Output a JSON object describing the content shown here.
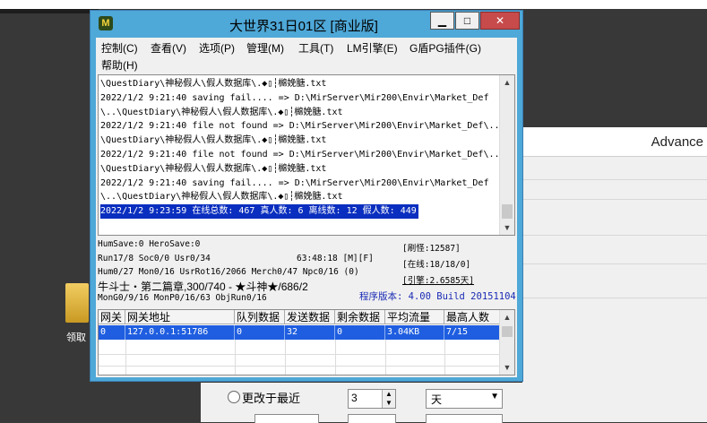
{
  "desktop": {
    "folder_label": "领取"
  },
  "bg_window": {
    "header_text": "Advance",
    "radio_label": "更改于最近",
    "spin_value": "3",
    "select_value": "天"
  },
  "window": {
    "title": "大世界31日01区 [商业版]",
    "buttons": {
      "minimize": "▁",
      "maximize": "□",
      "close": "✕"
    },
    "menu": [
      "控制(C)",
      "查看(V)",
      "选项(P)",
      "管理(M)",
      "工具(T)",
      "LM引擎(E)",
      "G盾PG插件(G)",
      "帮助(H)"
    ],
    "log_lines": [
      "\\QuestDiary\\神秘假人\\假人数据库\\.◆▯┆檰娩膅.txt",
      "2022/1/2 9:21:40 saving fail.... => D:\\MirServer\\Mir200\\Envir\\Market_Def",
      "\\..\\QuestDiary\\神秘假人\\假人数据库\\.◆▯┆檰娩膅.txt",
      "2022/1/2 9:21:40 file not found => D:\\MirServer\\Mir200\\Envir\\Market_Def\\..",
      "\\QuestDiary\\神秘假人\\假人数据库\\.◆▯┆檰娩膅.txt",
      "2022/1/2 9:21:40 file not found => D:\\MirServer\\Mir200\\Envir\\Market_Def\\..",
      "\\QuestDiary\\神秘假人\\假人数据库\\.◆▯┆檰娩膅.txt",
      "2022/1/2 9:21:40 saving fail.... => D:\\MirServer\\Mir200\\Envir\\Market_Def",
      "\\..\\QuestDiary\\神秘假人\\假人数据库\\.◆▯┆檰娩膅.txt"
    ],
    "log_selected": "2022/1/2 9:23:59 在线总数: 467 真人数: 6 离线数: 12 假人数: 449",
    "stats": {
      "humsave": "HumSave:0 HeroSave:0",
      "run": "Run17/8 Soc0/0 Usr0/34",
      "time": "63:48:18 [M][F]",
      "hum": "Hum0/27 Mon0/16 UsrRot16/2066 Merch0/47 Npc0/16 (0)",
      "fighter": "牛斗士・第二篇章,300/740 - ★斗神★/686/2",
      "mon": "MonG0/9/16 MonP0/16/63 ObjRun0/16",
      "refresh": "[刷怪:12587]",
      "online": "[在线:18/18/0]",
      "engine": "[引擎:2.6585天]",
      "version": "程序版本: 4.00 Build 20151104"
    },
    "grid": {
      "headers": [
        "网关",
        "网关地址",
        "队列数据",
        "发送数据",
        "剩余数据",
        "平均流量",
        "最高人数"
      ],
      "rows": [
        [
          "0",
          "127.0.0.1:51786",
          "0",
          "32",
          "0",
          "3.04KB",
          "7/15"
        ]
      ]
    }
  }
}
